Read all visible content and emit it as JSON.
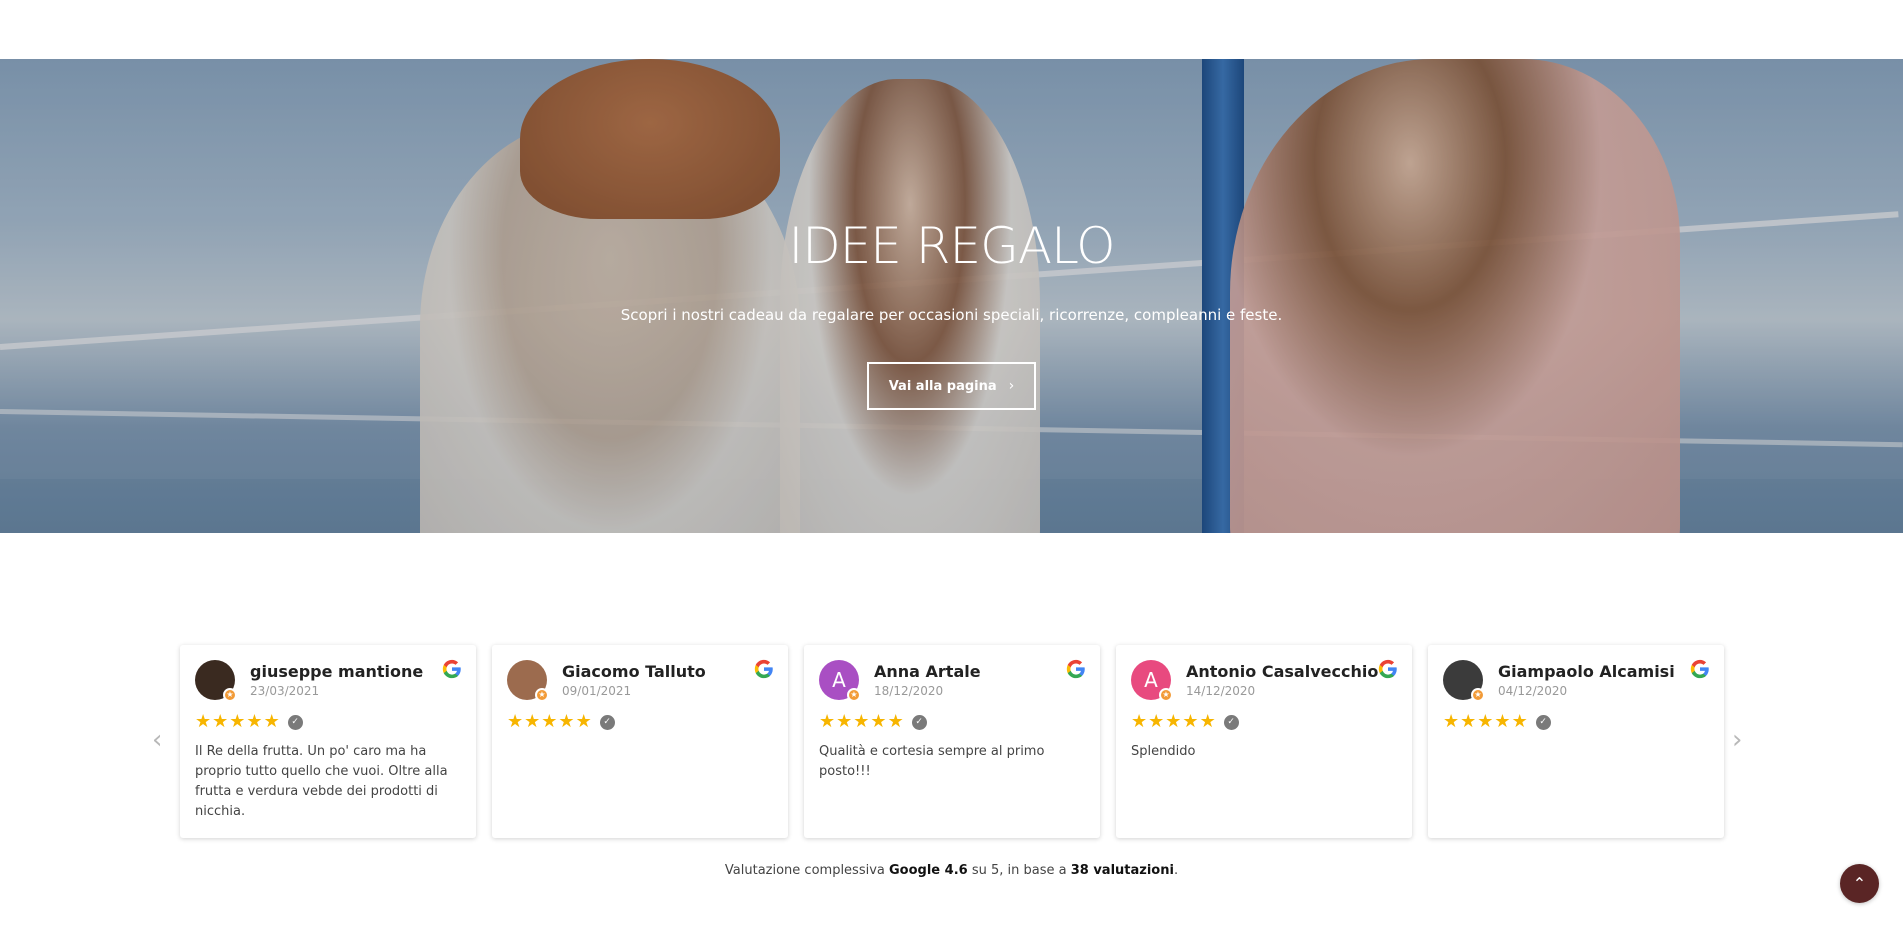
{
  "hero": {
    "title": "IDEE REGALO",
    "subtitle": "Scopri i nostri cadeau da regalare per occasioni speciali, ricorrenze, compleanni e feste.",
    "button_label": "Vai alla pagina",
    "button_icon": "chevron-right-icon"
  },
  "reviews": {
    "prev_icon": "‹",
    "next_icon": "›",
    "items": [
      {
        "name": "giuseppe mantione",
        "date": "23/03/2021",
        "rating": 5,
        "text": "Il Re della frutta. Un po' caro ma ha proprio tutto quello che vuoi. Oltre alla frutta e verdura vebde dei prodotti di nicchia.",
        "avatar_color": "#3a2a20",
        "avatar_letter": ""
      },
      {
        "name": "Giacomo Talluto",
        "date": "09/01/2021",
        "rating": 5,
        "text": "",
        "avatar_color": "#9c6b4e",
        "avatar_letter": ""
      },
      {
        "name": "Anna Artale",
        "date": "18/12/2020",
        "rating": 5,
        "text": "Qualità e cortesia sempre al primo posto!!!",
        "avatar_color": "#a94fc3",
        "avatar_letter": "A"
      },
      {
        "name": "Antonio Casalvecchio",
        "date": "14/12/2020",
        "rating": 5,
        "text": "Splendido",
        "avatar_color": "#e84a7f",
        "avatar_letter": "A"
      },
      {
        "name": "Giampaolo Alcamisi",
        "date": "04/12/2020",
        "rating": 5,
        "text": "",
        "avatar_color": "#3b3b3b",
        "avatar_letter": ""
      }
    ]
  },
  "summary": {
    "prefix": "Valutazione complessiva ",
    "brand_score": "Google 4.6",
    "middle": " su 5, in base a ",
    "count": "38 valutazioni",
    "suffix": "."
  },
  "back_to_top_icon": "⌃"
}
